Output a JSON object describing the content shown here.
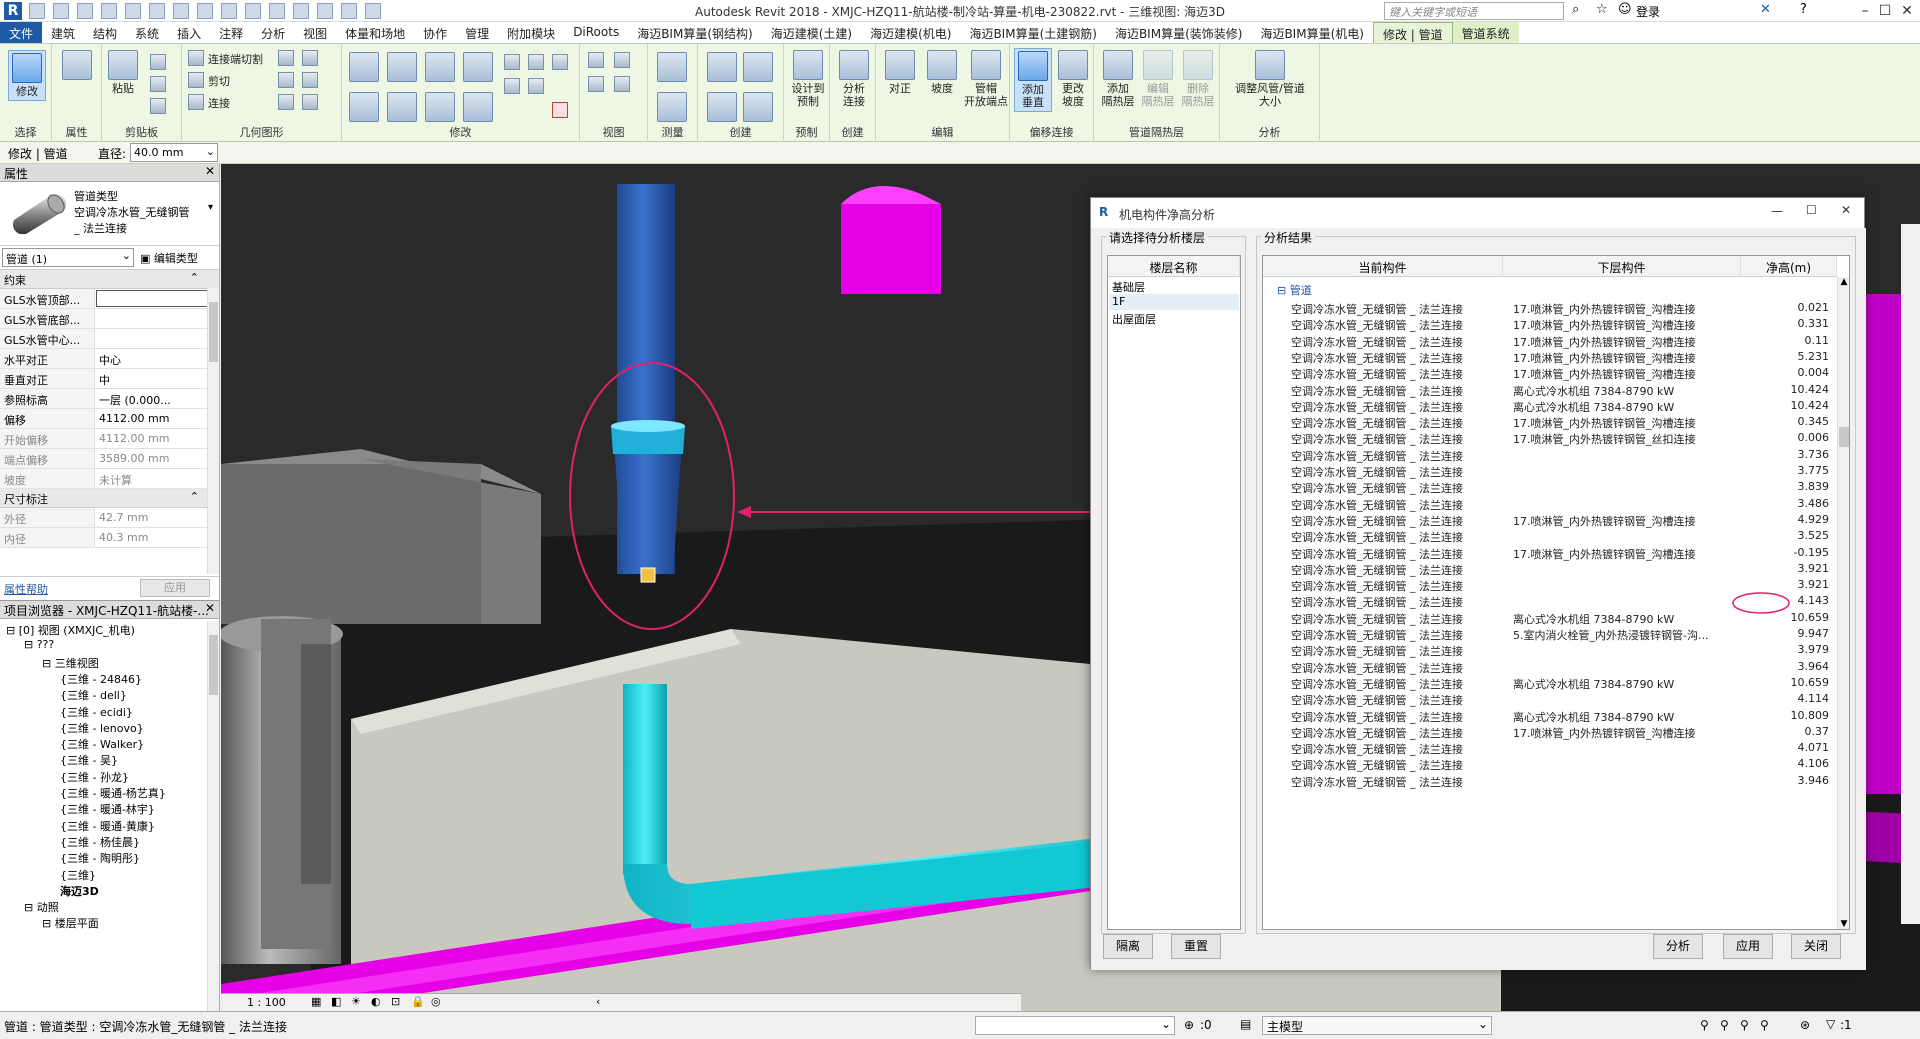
{
  "app": {
    "title": "Autodesk Revit 2018 -    XMJC-HZQ11-航站楼-制冷站-算量-机电-230822.rvt - 三维视图: 海迈3D",
    "search_placeholder": "键入关键字或短语",
    "login": "登录"
  },
  "tabs": [
    "文件",
    "建筑",
    "结构",
    "系统",
    "插入",
    "注释",
    "分析",
    "视图",
    "体量和场地",
    "协作",
    "管理",
    "附加模块",
    "DiRoots",
    "海迈BIM算量(钢结构)",
    "海迈建模(土建)",
    "海迈建模(机电)",
    "海迈BIM算量(土建钢筋)",
    "海迈BIM算量(装饰装修)",
    "海迈BIM算量(机电)",
    "修改 | 管道",
    "管道系统"
  ],
  "ribbon": {
    "panels": [
      "选择",
      "属性",
      "剪贴板",
      "几何图形",
      "修改",
      "视图",
      "测量",
      "创建",
      "预制",
      "创建",
      "编辑",
      "偏移连接",
      "管道隔热层",
      "分析"
    ],
    "modify": "修改",
    "paste": "粘贴",
    "cut_join": "连接端切割",
    "cut": "剪切",
    "join": "连接",
    "design_prefab": "设计到\n预制",
    "analyze_connect": "分析\n连接",
    "justify": "对正",
    "slope": "坡度",
    "cap": "管帽\n开放端点",
    "add_vertical": "添加\n垂直",
    "change_slope": "更改\n坡度",
    "add_insulation": "添加\n隔热层",
    "edit_insulation": "编辑\n隔热层",
    "remove_insulation": "删除\n隔热层",
    "resize": "调整风管/管道\n大小"
  },
  "optbar": {
    "context": "修改 | 管道",
    "diameter_label": "直径:",
    "diameter_value": "40.0 mm"
  },
  "properties": {
    "title": "属性",
    "type_line1": "管道类型",
    "type_line2": "空调冷冻水管_无缝钢管",
    "type_line3": "_ 法兰连接",
    "selector": "管道 (1)",
    "edit_type": "编辑类型",
    "sec_constraints": "约束",
    "rows": [
      {
        "k": "GLS水管顶部...",
        "v": ""
      },
      {
        "k": "GLS水管底部...",
        "v": ""
      },
      {
        "k": "GLS水管中心...",
        "v": ""
      },
      {
        "k": "水平对正",
        "v": "中心"
      },
      {
        "k": "垂直对正",
        "v": "中"
      },
      {
        "k": "参照标高",
        "v": "一层    (0.000..."
      },
      {
        "k": "偏移",
        "v": "4112.00 mm"
      },
      {
        "k": "开始偏移",
        "v": "4112.00 mm"
      },
      {
        "k": "端点偏移",
        "v": "3589.00 mm"
      },
      {
        "k": "坡度",
        "v": "未计算"
      }
    ],
    "sec_dims": "尺寸标注",
    "dim_rows": [
      {
        "k": "外径",
        "v": "42.7 mm"
      },
      {
        "k": "内径",
        "v": "40.3 mm"
      }
    ],
    "help": "属性帮助",
    "apply": "应用"
  },
  "browser": {
    "title": "项目浏览器 - XMJC-HZQ11-航站楼-...",
    "nodes": [
      {
        "t": "[0] 视图 (XMXJC_机电)",
        "lvl": 0,
        "b": "⊟"
      },
      {
        "t": "???",
        "lvl": 1,
        "b": "⊟"
      },
      {
        "t": "三维视图",
        "lvl": 2,
        "b": "⊟"
      },
      {
        "t": "{三维 - 24846}",
        "lvl": 3
      },
      {
        "t": "{三维 - dell}",
        "lvl": 3
      },
      {
        "t": "{三维 - ecidi}",
        "lvl": 3
      },
      {
        "t": "{三维 - lenovo}",
        "lvl": 3
      },
      {
        "t": "{三维 - Walker}",
        "lvl": 3
      },
      {
        "t": "{三维 - 吴}",
        "lvl": 3
      },
      {
        "t": "{三维 - 孙龙}",
        "lvl": 3
      },
      {
        "t": "{三维 - 暖通-杨艺真}",
        "lvl": 3
      },
      {
        "t": "{三维 - 暖通-林宇}",
        "lvl": 3
      },
      {
        "t": "{三维 - 暖通-黄康}",
        "lvl": 3
      },
      {
        "t": "{三维 - 杨佳晨}",
        "lvl": 3
      },
      {
        "t": "{三维 - 陶明彤}",
        "lvl": 3
      },
      {
        "t": "{三维}",
        "lvl": 3
      },
      {
        "t": "海迈3D",
        "lvl": 3,
        "bold": true
      },
      {
        "t": "动照",
        "lvl": 1,
        "b": "⊟"
      },
      {
        "t": "楼层平面",
        "lvl": 2,
        "b": "⊟"
      }
    ]
  },
  "viewctl": {
    "scale": "1 : 100"
  },
  "status": {
    "text": "管道 : 管道类型 : 空调冷冻水管_无缝钢管 _ 法兰连接",
    "zero": ":0",
    "model": "主模型",
    "filter": ":1"
  },
  "dialog": {
    "title": "机电构件净高分析",
    "left_group": "请选择待分析楼层",
    "left_header": "楼层名称",
    "floors": [
      "基础层",
      "1F",
      "出屋面层"
    ],
    "right_group": "分析结果",
    "headers": [
      "当前构件",
      "下层构件",
      "净高(m)"
    ],
    "group_name": "管道",
    "rows": [
      {
        "a": "空调冷冻水管_无缝钢管 _ 法兰连接",
        "b": "17.喷淋管_内外热镀锌钢管_沟槽连接",
        "h": "0.021"
      },
      {
        "a": "空调冷冻水管_无缝钢管 _ 法兰连接",
        "b": "17.喷淋管_内外热镀锌钢管_沟槽连接",
        "h": "0.331"
      },
      {
        "a": "空调冷冻水管_无缝钢管 _ 法兰连接",
        "b": "17.喷淋管_内外热镀锌钢管_沟槽连接",
        "h": "0.11"
      },
      {
        "a": "空调冷冻水管_无缝钢管 _ 法兰连接",
        "b": "17.喷淋管_内外热镀锌钢管_沟槽连接",
        "h": "5.231"
      },
      {
        "a": "空调冷冻水管_无缝钢管 _ 法兰连接",
        "b": "17.喷淋管_内外热镀锌钢管_沟槽连接",
        "h": "0.004"
      },
      {
        "a": "空调冷冻水管_无缝钢管 _ 法兰连接",
        "b": "离心式冷水机组 7384-8790 kW",
        "h": "10.424"
      },
      {
        "a": "空调冷冻水管_无缝钢管 _ 法兰连接",
        "b": "离心式冷水机组 7384-8790 kW",
        "h": "10.424"
      },
      {
        "a": "空调冷冻水管_无缝钢管 _ 法兰连接",
        "b": "17.喷淋管_内外热镀锌钢管_沟槽连接",
        "h": "0.345"
      },
      {
        "a": "空调冷冻水管_无缝钢管 _ 法兰连接",
        "b": "17.喷淋管_内外热镀锌钢管_丝扣连接",
        "h": "0.006"
      },
      {
        "a": "空调冷冻水管_无缝钢管 _ 法兰连接",
        "b": "",
        "h": "3.736"
      },
      {
        "a": "空调冷冻水管_无缝钢管 _ 法兰连接",
        "b": "",
        "h": "3.775"
      },
      {
        "a": "空调冷冻水管_无缝钢管 _ 法兰连接",
        "b": "",
        "h": "3.839"
      },
      {
        "a": "空调冷冻水管_无缝钢管 _ 法兰连接",
        "b": "",
        "h": "3.486"
      },
      {
        "a": "空调冷冻水管_无缝钢管 _ 法兰连接",
        "b": "17.喷淋管_内外热镀锌钢管_沟槽连接",
        "h": "4.929"
      },
      {
        "a": "空调冷冻水管_无缝钢管 _ 法兰连接",
        "b": "",
        "h": "3.525"
      },
      {
        "a": "空调冷冻水管_无缝钢管 _ 法兰连接",
        "b": "17.喷淋管_内外热镀锌钢管_沟槽连接",
        "h": "-0.195"
      },
      {
        "a": "空调冷冻水管_无缝钢管 _ 法兰连接",
        "b": "",
        "h": "3.921"
      },
      {
        "a": "空调冷冻水管_无缝钢管 _ 法兰连接",
        "b": "",
        "h": "3.921"
      },
      {
        "a": "空调冷冻水管_无缝钢管 _ 法兰连接",
        "b": "",
        "h": "4.143"
      },
      {
        "a": "空调冷冻水管_无缝钢管 _ 法兰连接",
        "b": "离心式冷水机组 7384-8790 kW",
        "h": "10.659"
      },
      {
        "a": "空调冷冻水管_无缝钢管 _ 法兰连接",
        "b": "5.室内消火栓管_内外热浸镀锌钢管-沟...",
        "h": "9.947"
      },
      {
        "a": "空调冷冻水管_无缝钢管 _ 法兰连接",
        "b": "",
        "h": "3.979"
      },
      {
        "a": "空调冷冻水管_无缝钢管 _ 法兰连接",
        "b": "",
        "h": "3.964"
      },
      {
        "a": "空调冷冻水管_无缝钢管 _ 法兰连接",
        "b": "离心式冷水机组 7384-8790 kW",
        "h": "10.659"
      },
      {
        "a": "空调冷冻水管_无缝钢管 _ 法兰连接",
        "b": "",
        "h": "4.114"
      },
      {
        "a": "空调冷冻水管_无缝钢管 _ 法兰连接",
        "b": "离心式冷水机组 7384-8790 kW",
        "h": "10.809"
      },
      {
        "a": "空调冷冻水管_无缝钢管 _ 法兰连接",
        "b": "17.喷淋管_内外热镀锌钢管_沟槽连接",
        "h": "0.37"
      },
      {
        "a": "空调冷冻水管_无缝钢管 _ 法兰连接",
        "b": "",
        "h": "4.071"
      },
      {
        "a": "空调冷冻水管_无缝钢管 _ 法兰连接",
        "b": "",
        "h": "4.106"
      },
      {
        "a": "空调冷冻水管_无缝钢管 _ 法兰连接",
        "b": "",
        "h": "3.946"
      }
    ],
    "highlight_index": 15,
    "btn_isolate": "隔离",
    "btn_reset": "重置",
    "btn_analyze": "分析",
    "btn_apply": "应用",
    "btn_close": "关闭"
  },
  "colors": {
    "pipe_blue": "#2f63b8",
    "pipe_cyan": "#19d4e0",
    "pipe_magenta": "#e600e6",
    "annotation": "#e0206a",
    "ribbon_bg": "#eef6e4"
  }
}
